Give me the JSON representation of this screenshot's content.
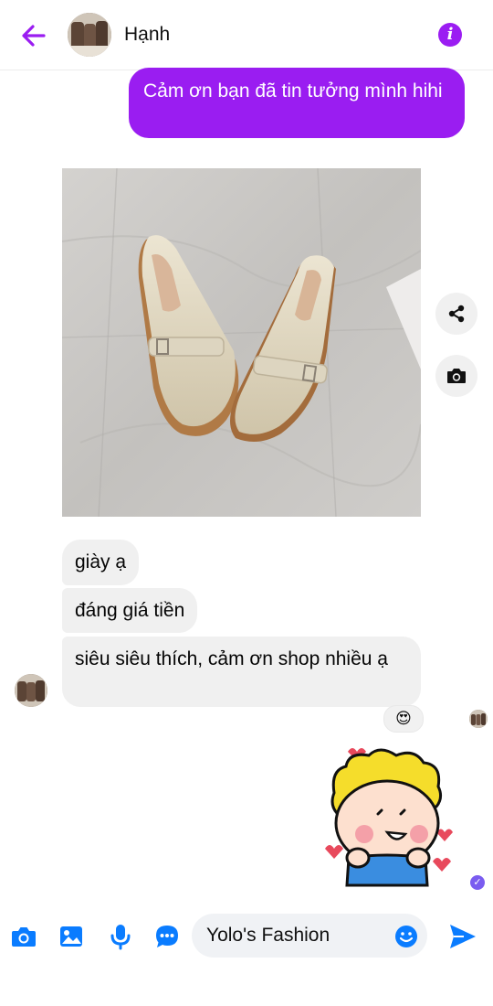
{
  "header": {
    "contact_name": "Hạnh",
    "info_glyph": "i",
    "icons": [
      "back-arrow-icon",
      "info-icon"
    ]
  },
  "messages": {
    "outgoing_1": "Cảm ơn bạn đã tin tưởng mình hihi",
    "incoming": [
      "giày ạ",
      "đáng giá tiền",
      "siêu siêu thích, cảm ơn shop nhiều ạ"
    ],
    "reaction": "😍"
  },
  "composer": {
    "input_value": "Yolo's Fashion"
  },
  "colors": {
    "accent_purple": "#9a1df1",
    "messenger_blue": "#0a7cff",
    "bubble_grey": "#f0f0f0"
  }
}
